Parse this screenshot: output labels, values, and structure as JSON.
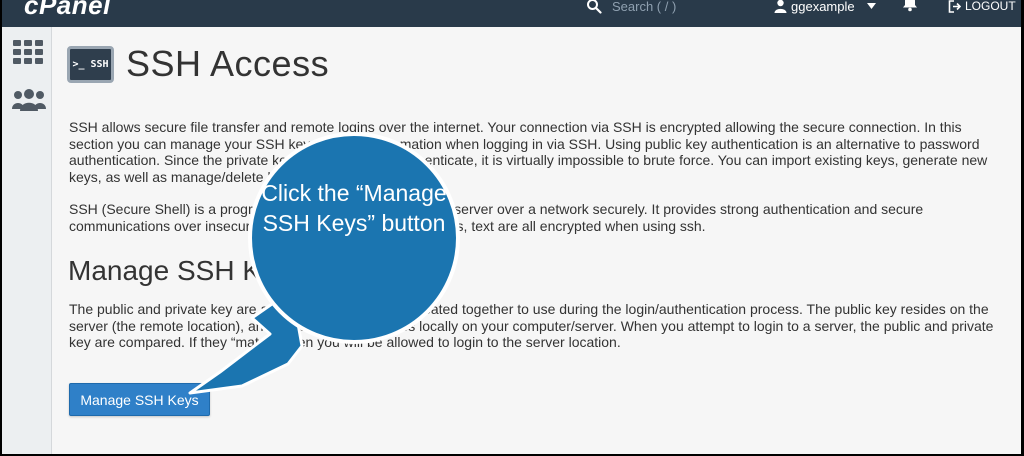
{
  "topbar": {
    "logo": "cPanel",
    "search_placeholder": "Search ( / )",
    "username": "ggexample",
    "logout_label": "LOGOUT"
  },
  "sidebar": {
    "icons": [
      "grid-icon",
      "users-icon"
    ]
  },
  "page": {
    "icon_label": ">_ SSH",
    "title": "SSH Access",
    "paragraph1": "SSH allows secure file transfer and remote logins over the internet. Your connection via SSH is encrypted allowing the secure connection. In this section you can manage your SSH keys to allow automation when logging in via SSH. Using public key authentication is an alternative to password authentication. Since the private key must be held to authenticate, it is virtually impossible to brute force. You can import existing keys, generate new keys, as well as manage/delete keys.",
    "paragraph2": "SSH (Secure Shell) is a program to log into another computer/server over a network securely. It provides strong authentication and secure communications over insecure channels. Your login, commands, text are all encrypted when using ssh.",
    "section_title": "Manage SSH Keys",
    "paragraph3": "The public and private key are a pair of keys which are created together to use during the login/authentication process. The public key resides on the server (the remote location), and the private key resides locally on your computer/server. When you attempt to login to a server, the public and private key are compared. If they “match”, then you will be allowed to login to the server location.",
    "manage_button": "Manage SSH Keys"
  },
  "callout": {
    "text": "Click the “Manage SSH Keys” button",
    "color": "#1b75b0"
  }
}
